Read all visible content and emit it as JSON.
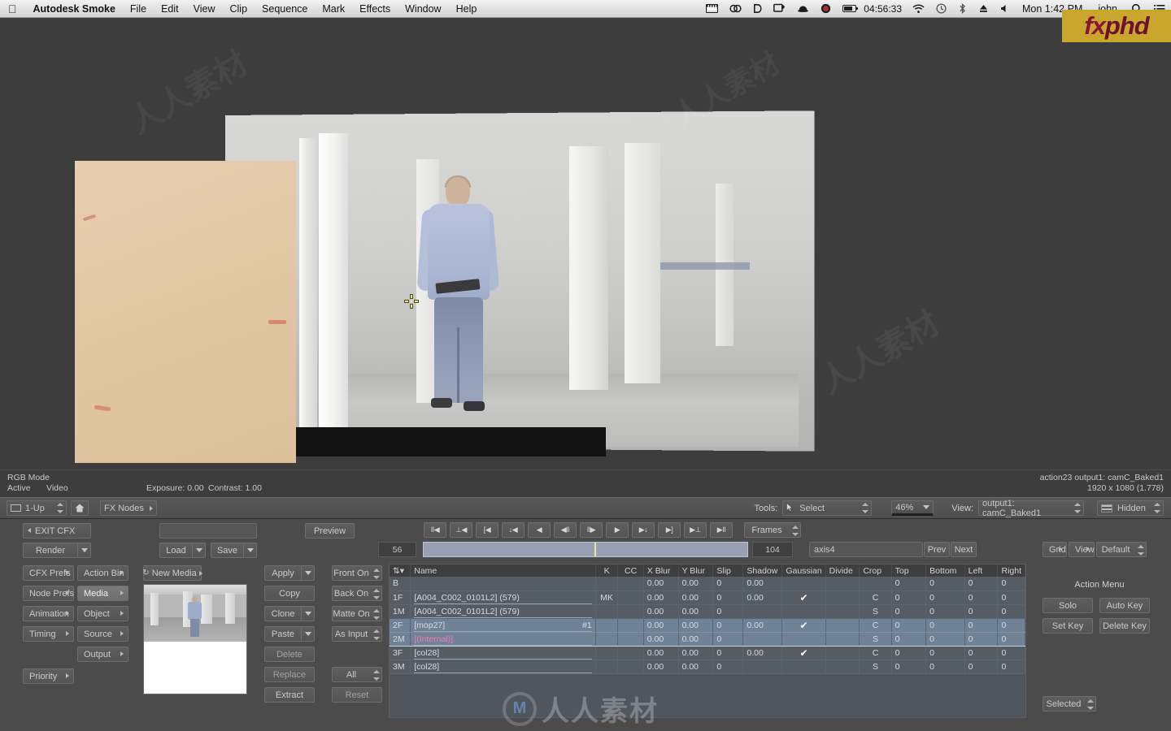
{
  "menubar": {
    "apple_icon": "apple-icon",
    "app_name": "Autodesk Smoke",
    "items": [
      "File",
      "Edit",
      "View",
      "Clip",
      "Sequence",
      "Mark",
      "Effects",
      "Window",
      "Help"
    ],
    "status_icons": [
      "film-icon",
      "cc-link-icon",
      "dropbox-icon",
      "display-icon",
      "bowler-hat-icon",
      "record-icon",
      "battery-icon"
    ],
    "timecode": "04:56:33",
    "wifi_icon": "wifi-icon",
    "timemachine_icon": "time-machine-icon",
    "bluetooth_icon": "bluetooth-icon",
    "eject_icon": "eject-icon",
    "volume_icon": "volume-icon",
    "clock": "Mon 1:42 PM",
    "user": "john",
    "search_icon": "search-icon",
    "notifications_icon": "notification-center-icon"
  },
  "logo": {
    "part1": "fx",
    "part2": "phd"
  },
  "viewport": {
    "crosshair_icon": "axis-crosshair-icon"
  },
  "status": {
    "mode": "RGB Mode",
    "active": "Active",
    "video": "Video",
    "exposure": "Exposure: 0.00",
    "contrast": "Contrast: 1.00",
    "node_info": "action23 output1: camC_Baked1",
    "resolution": "1920 x 1080 (1.778)"
  },
  "toolbar": {
    "layout_icon": "layout-grid-icon",
    "layout_value": "1-Up",
    "home_icon": "home-icon",
    "fx_nodes": "FX Nodes",
    "tools_label": "Tools:",
    "tool_cursor_icon": "arrow-cursor-icon",
    "tool_value": "Select",
    "zoom_value": "46%",
    "view_label": "View:",
    "view_value": "output1: camC_Baked1",
    "hidden_icon": "layers-hidden-icon",
    "hidden_value": "Hidden"
  },
  "panel": {
    "exit_cfx": "EXIT CFX",
    "render": "Render",
    "name_field_value": "",
    "load": "Load",
    "save": "Save",
    "preview": "Preview",
    "tabs_left": [
      "CFX Prefs",
      "Node Prefs",
      "Animation",
      "Timing"
    ],
    "tabs_right": [
      "Action Bin",
      "Media",
      "Object",
      "Source",
      "Output"
    ],
    "active_tab": "Media",
    "priority": "Priority",
    "new_media": "New Media",
    "new_media_icon": "refresh-icon",
    "ops": [
      "Apply",
      "Copy",
      "Clone",
      "Paste",
      "Delete",
      "Replace",
      "Extract"
    ],
    "ops_split": [
      true,
      false,
      true,
      true,
      false,
      false,
      false
    ],
    "modes": [
      "Front On",
      "Back On",
      "Matte On",
      "As Input",
      "",
      "All",
      "Reset"
    ]
  },
  "transport": {
    "buttons": [
      "II◀",
      "⊥◀",
      "[◀",
      "↓◀",
      "◀",
      "◀II",
      "II▶",
      "▶",
      "▶↓",
      "▶]",
      "▶⊥",
      "▶II"
    ],
    "units": "Frames"
  },
  "timeline": {
    "in_point": "56",
    "out_point": "104",
    "axis_field": "axis4",
    "prev": "Prev",
    "next": "Next",
    "grid": "Grid",
    "view": "View",
    "default": "Default"
  },
  "table": {
    "columns": [
      "",
      "Name",
      "K",
      "CC",
      "X Blur",
      "Y Blur",
      "Slip",
      "Shadow",
      "Gaussian",
      "Divide",
      "Crop",
      "Top",
      "Bottom",
      "Left",
      "Right"
    ],
    "sort_icon": "sort-arrow-icon",
    "rows": [
      {
        "idx": "B",
        "name": "",
        "name_color": "normal",
        "hash": "",
        "k": "",
        "cc": "",
        "xblur": "0.00",
        "yblur": "0.00",
        "slip": "0",
        "shadow": "0.00",
        "gaussian": "",
        "divide": "",
        "crop": "",
        "top": "0",
        "bottom": "0",
        "left": "0",
        "right": "0",
        "selected": false,
        "group": 0,
        "group_pos": "single"
      },
      {
        "idx": "1F",
        "name": "[A004_C002_0101L2] (579)",
        "name_color": "normal",
        "hash": "",
        "k": "MK",
        "cc": "",
        "xblur": "0.00",
        "yblur": "0.00",
        "slip": "0",
        "shadow": "0.00",
        "gaussian": "✔",
        "divide": "",
        "crop": "C",
        "top": "0",
        "bottom": "0",
        "left": "0",
        "right": "0",
        "selected": false,
        "group": 1,
        "group_pos": "first"
      },
      {
        "idx": "1M",
        "name": "[A004_C002_0101L2] (579)",
        "name_color": "normal",
        "hash": "",
        "k": "",
        "cc": "",
        "xblur": "0.00",
        "yblur": "0.00",
        "slip": "0",
        "shadow": "",
        "gaussian": "",
        "divide": "",
        "crop": "S",
        "top": "0",
        "bottom": "0",
        "left": "0",
        "right": "0",
        "selected": false,
        "group": 1,
        "group_pos": "last"
      },
      {
        "idx": "2F",
        "name": "[mop27]",
        "name_color": "normal",
        "hash": "#1",
        "k": "",
        "cc": "",
        "xblur": "0.00",
        "yblur": "0.00",
        "slip": "0",
        "shadow": "0.00",
        "gaussian": "✔",
        "divide": "",
        "crop": "C",
        "top": "0",
        "bottom": "0",
        "left": "0",
        "right": "0",
        "selected": true,
        "group": 2,
        "group_pos": "first"
      },
      {
        "idx": "2M",
        "name": "[(Internal)]",
        "name_color": "pink",
        "hash": "",
        "k": "",
        "cc": "",
        "xblur": "0.00",
        "yblur": "0.00",
        "slip": "0",
        "shadow": "",
        "gaussian": "",
        "divide": "",
        "crop": "S",
        "top": "0",
        "bottom": "0",
        "left": "0",
        "right": "0",
        "selected": true,
        "group": 2,
        "group_pos": "last"
      },
      {
        "idx": "3F",
        "name": "[col28]",
        "name_color": "normal",
        "hash": "",
        "k": "",
        "cc": "",
        "xblur": "0.00",
        "yblur": "0.00",
        "slip": "0",
        "shadow": "0.00",
        "gaussian": "✔",
        "divide": "",
        "crop": "C",
        "top": "0",
        "bottom": "0",
        "left": "0",
        "right": "0",
        "selected": false,
        "group": 3,
        "group_pos": "first"
      },
      {
        "idx": "3M",
        "name": "[col28]",
        "name_color": "normal",
        "hash": "",
        "k": "",
        "cc": "",
        "xblur": "0.00",
        "yblur": "0.00",
        "slip": "0",
        "shadow": "",
        "gaussian": "",
        "divide": "",
        "crop": "S",
        "top": "0",
        "bottom": "0",
        "left": "0",
        "right": "0",
        "selected": false,
        "group": 3,
        "group_pos": "last"
      }
    ]
  },
  "action_menu": {
    "title": "Action Menu",
    "solo": "Solo",
    "auto_key": "Auto Key",
    "set_key": "Set Key",
    "delete_key": "Delete Key",
    "selected": "Selected"
  },
  "watermark": {
    "center_text": "人人素材",
    "center_mark": "M"
  },
  "colors": {
    "window_bg": "#4b4b4b",
    "viewport_bg": "#3d3d3d",
    "table_row": "#555c64",
    "table_row_selected": "#6f8296",
    "accent_pink": "#f27ab0",
    "playhead": "#e8e5a8",
    "logo_bg": "#c8a72c"
  }
}
